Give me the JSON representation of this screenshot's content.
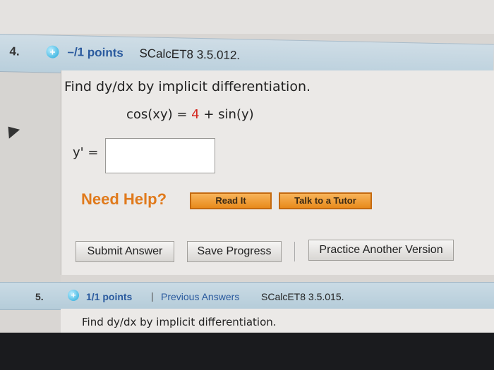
{
  "q4": {
    "number": "4.",
    "plus": "+",
    "points": "–/1 points",
    "ref": "SCalcET8 3.5.012.",
    "prompt": "Find dy/dx by implicit differentiation.",
    "equation_left": "cos(xy) = ",
    "equation_red": "4",
    "equation_right": " + sin(y)",
    "answer_label": "y' =",
    "answer_value": "",
    "need_help": "Need Help?",
    "read_it": "Read It",
    "talk_tutor": "Talk to a Tutor",
    "submit": "Submit Answer",
    "save": "Save Progress",
    "practice": "Practice Another Version"
  },
  "q5": {
    "number": "5.",
    "plus": "+",
    "points": "1/1 points",
    "separator": "|",
    "previous_answers": "Previous Answers",
    "ref": "SCalcET8 3.5.015.",
    "prompt": "Find dy/dx by implicit differentiation."
  },
  "colors": {
    "points": "#2a5a9e",
    "need_help": "#e07a1c",
    "equation_accent": "#d4271f",
    "header": "#c4d7e2"
  },
  "icons": {
    "plus": "plus-circle-icon",
    "cursor": "mouse-cursor-icon"
  }
}
